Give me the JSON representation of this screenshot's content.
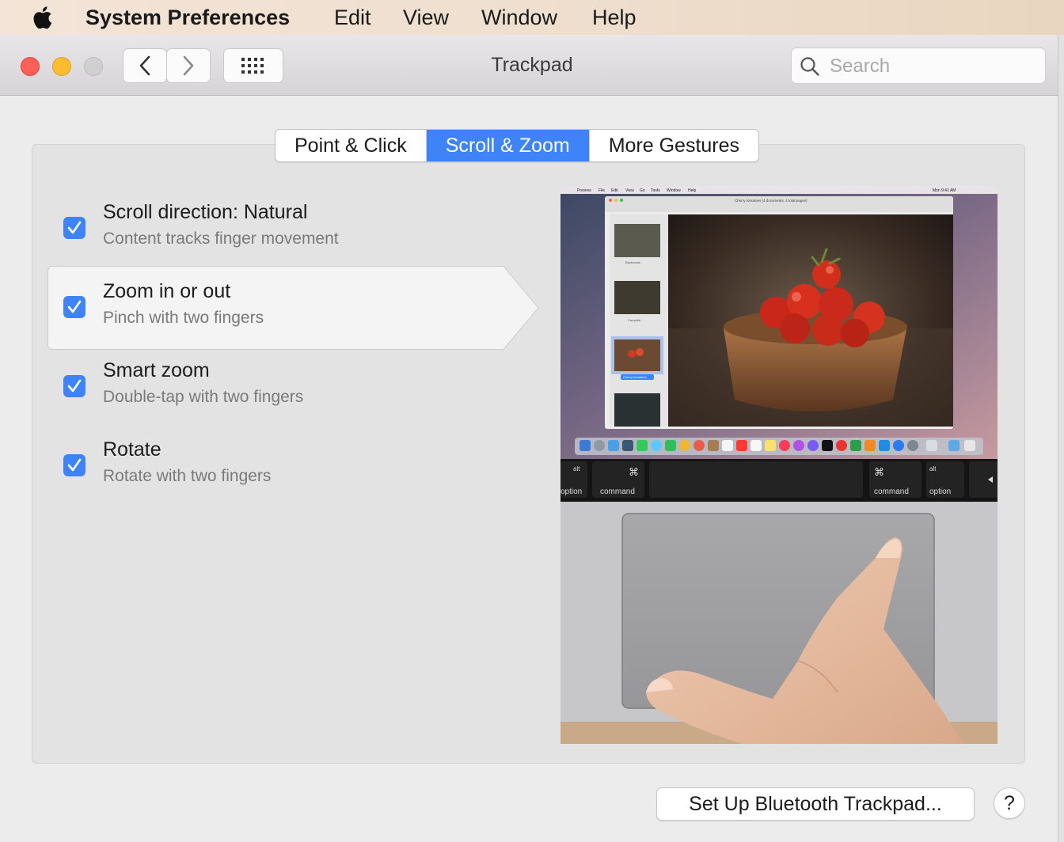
{
  "menubar": {
    "app_name": "System Preferences",
    "items": [
      "Edit",
      "View",
      "Window",
      "Help"
    ]
  },
  "window": {
    "title": "Trackpad",
    "search": {
      "placeholder": "Search",
      "value": ""
    }
  },
  "tabs": [
    {
      "label": "Point & Click",
      "active": false
    },
    {
      "label": "Scroll & Zoom",
      "active": true
    },
    {
      "label": "More Gestures",
      "active": false
    }
  ],
  "options": [
    {
      "title": "Scroll direction: Natural",
      "subtitle": "Content tracks finger movement",
      "checked": true
    },
    {
      "title": "Zoom in or out",
      "subtitle": "Pinch with two fingers",
      "checked": true,
      "selected": true
    },
    {
      "title": "Smart zoom",
      "subtitle": "Double-tap with two fingers",
      "checked": true
    },
    {
      "title": "Rotate",
      "subtitle": "Rotate with two fingers",
      "checked": true
    }
  ],
  "preview": {
    "menubar_items": [
      "Preview",
      "File",
      "Edit",
      "View",
      "Go",
      "Tools",
      "Window",
      "Help"
    ],
    "clock": "Mon 9:41 AM",
    "doc_title": "Cherry tomatoes (4 documents, 4 total pages)",
    "thumbnails": [
      "Backroads",
      "Campfire",
      "Cherry tomatoes",
      ""
    ],
    "keys": [
      {
        "top": "alt",
        "bottom": "option"
      },
      {
        "top": "⌘",
        "bottom": "command"
      },
      {
        "top": "⌘",
        "bottom": "command"
      },
      {
        "top": "alt",
        "bottom": "option"
      }
    ]
  },
  "footer": {
    "bluetooth_button": "Set Up Bluetooth Trackpad...",
    "help_button": "?"
  },
  "colors": {
    "accent": "#3f83f8",
    "close": "#fe5f57",
    "minimize": "#febc2e"
  }
}
